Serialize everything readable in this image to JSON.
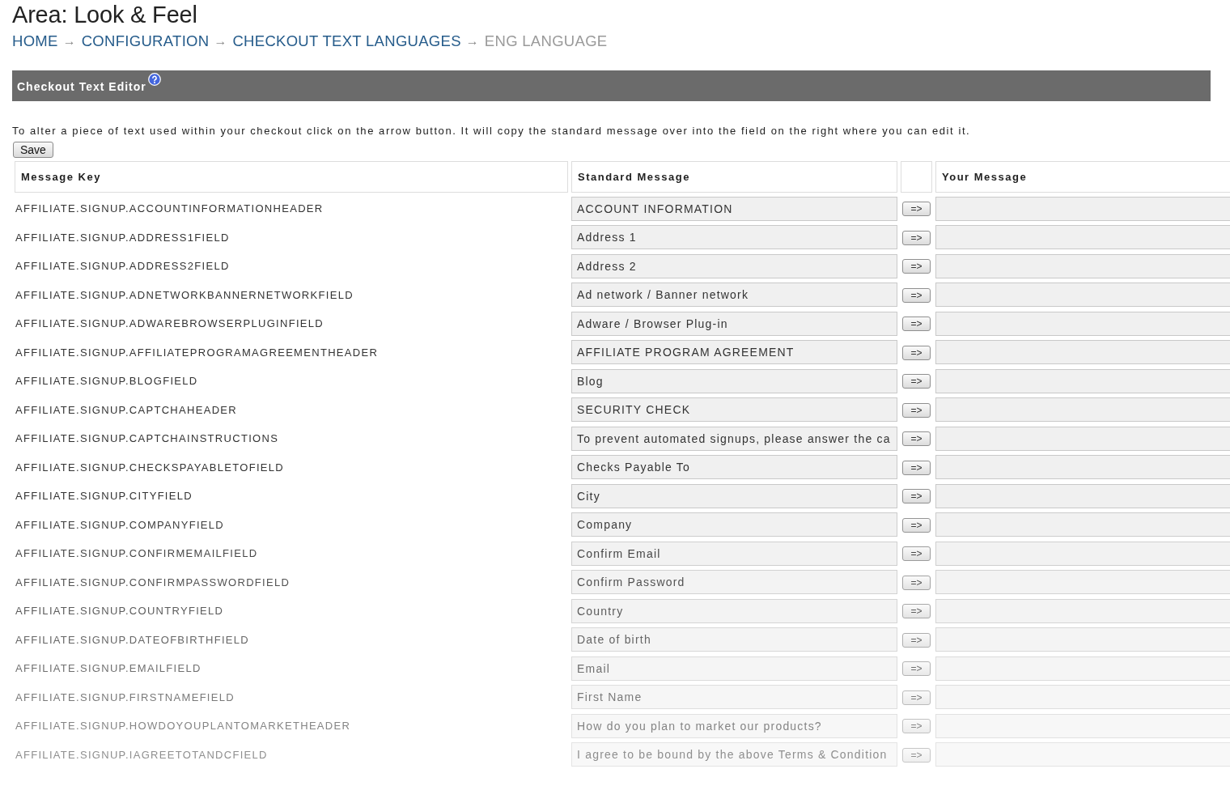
{
  "page": {
    "title": "Area: Look & Feel"
  },
  "breadcrumb": [
    {
      "label": "HOME",
      "current": false,
      "separator": "→"
    },
    {
      "label": "CONFIGURATION",
      "current": false,
      "separator": "→"
    },
    {
      "label": "CHECKOUT TEXT LANGUAGES",
      "current": false,
      "separator": "→"
    },
    {
      "label": "ENG LANGUAGE",
      "current": true
    }
  ],
  "panel": {
    "title": "Checkout Text Editor",
    "instructions": "To alter a piece of text used within your checkout click on the arrow button. It will copy the standard message over into the field on the right where you can edit it.",
    "save_button": "Save"
  },
  "table": {
    "columns": {
      "message_key": "Message Key",
      "standard_message": "Standard Message",
      "your_message": "Your Message"
    },
    "rows": [
      {
        "key": "AFFILIATE.SIGNUP.ACCOUNTINFORMATIONHEADER",
        "standard_message": "ACCOUNT INFORMATION",
        "copy_button": "=>"
      },
      {
        "key": "AFFILIATE.SIGNUP.ADDRESS1FIELD",
        "standard_message": "Address 1",
        "copy_button": "=>"
      },
      {
        "key": "AFFILIATE.SIGNUP.ADDRESS2FIELD",
        "standard_message": "Address 2",
        "copy_button": "=>"
      },
      {
        "key": "AFFILIATE.SIGNUP.ADNETWORKBANNERNETWORKFIELD",
        "standard_message": "Ad network / Banner network",
        "copy_button": "=>"
      },
      {
        "key": "AFFILIATE.SIGNUP.ADWAREBROWSERPLUGINFIELD",
        "standard_message": "Adware / Browser Plug-in",
        "copy_button": "=>"
      },
      {
        "key": "AFFILIATE.SIGNUP.AFFILIATEPROGRAMAGREEMENTHEADER",
        "standard_message": "AFFILIATE PROGRAM AGREEMENT",
        "copy_button": "=>"
      },
      {
        "key": "AFFILIATE.SIGNUP.BLOGFIELD",
        "standard_message": "Blog",
        "copy_button": "=>"
      },
      {
        "key": "AFFILIATE.SIGNUP.CAPTCHAHEADER",
        "standard_message": "SECURITY CHECK",
        "copy_button": "=>"
      },
      {
        "key": "AFFILIATE.SIGNUP.CAPTCHAINSTRUCTIONS",
        "standard_message": "To prevent automated signups, please answer the ca",
        "copy_button": "=>"
      },
      {
        "key": "AFFILIATE.SIGNUP.CHECKSPAYABLETOFIELD",
        "standard_message": "Checks Payable To",
        "copy_button": "=>"
      },
      {
        "key": "AFFILIATE.SIGNUP.CITYFIELD",
        "standard_message": "City",
        "copy_button": "=>"
      },
      {
        "key": "AFFILIATE.SIGNUP.COMPANYFIELD",
        "standard_message": "Company",
        "copy_button": "=>"
      },
      {
        "key": "AFFILIATE.SIGNUP.CONFIRMEMAILFIELD",
        "standard_message": "Confirm Email",
        "copy_button": "=>"
      },
      {
        "key": "AFFILIATE.SIGNUP.CONFIRMPASSWORDFIELD",
        "standard_message": "Confirm Password",
        "copy_button": "=>"
      },
      {
        "key": "AFFILIATE.SIGNUP.COUNTRYFIELD",
        "standard_message": "Country",
        "copy_button": "=>"
      },
      {
        "key": "AFFILIATE.SIGNUP.DATEOFBIRTHFIELD",
        "standard_message": "Date of birth",
        "copy_button": "=>"
      },
      {
        "key": "AFFILIATE.SIGNUP.EMAILFIELD",
        "standard_message": "Email",
        "copy_button": "=>"
      },
      {
        "key": "AFFILIATE.SIGNUP.FIRSTNAMEFIELD",
        "standard_message": "First Name",
        "copy_button": "=>"
      },
      {
        "key": "AFFILIATE.SIGNUP.HOWDOYOUPLANTOMARKETHEADER",
        "standard_message": "How do you plan to market our products?",
        "copy_button": "=>"
      },
      {
        "key": "AFFILIATE.SIGNUP.IAGREETOTANDCFIELD",
        "standard_message": "I agree to be bound by the above Terms & Condition",
        "copy_button": "=>"
      }
    ]
  }
}
